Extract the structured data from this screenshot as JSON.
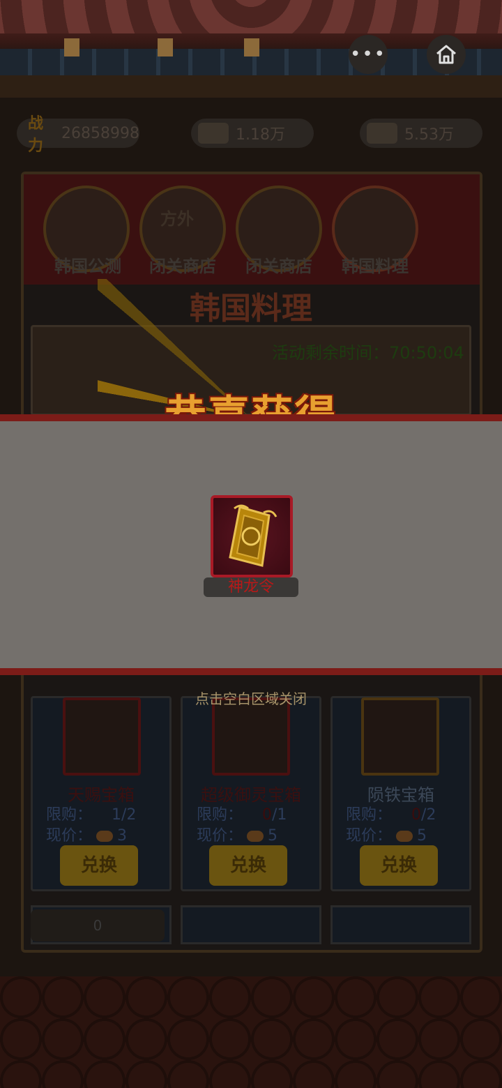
{
  "top_bar": {
    "more_icon": "more-dots-icon",
    "home_icon": "home-icon"
  },
  "resources": {
    "power_label": "战力",
    "power_value": "26858998",
    "gold_value": "1.18万",
    "silver_value": "5.53万"
  },
  "tabs": [
    {
      "label": "韩国公测"
    },
    {
      "label": "闭关商店"
    },
    {
      "label": "闭关商店"
    },
    {
      "label": "韩国料理"
    }
  ],
  "tab_badge": "方外",
  "section_title": "韩国料理",
  "timer_text": "活动剩余时间：70:50:04",
  "popup": {
    "title": "恭喜获得",
    "item_name": "神龙令",
    "item_icon": "dragon-token-icon",
    "close_hint": "点击空白区域关闭"
  },
  "shop": [
    {
      "name": "天赐宝箱",
      "limit_label": "限购：",
      "limit_used": "1",
      "limit_total": "/2",
      "price_label": "现价：",
      "price": "3",
      "button": "兑换"
    },
    {
      "name": "超级御灵宝箱",
      "limit_label": "限购：",
      "limit_used": "0",
      "limit_total": "/1",
      "price_label": "现价：",
      "price": "5",
      "button": "兑换"
    },
    {
      "name": "陨铁宝箱",
      "limit_label": "限购：",
      "limit_used": "0",
      "limit_total": "/2",
      "price_label": "现价：",
      "price": "5",
      "button": "兑换"
    }
  ],
  "balance": "0",
  "colors": {
    "modal_bg": "#74706c",
    "modal_border": "#7c1c18",
    "item_name": "#b81818",
    "headline": "#e8a030"
  }
}
